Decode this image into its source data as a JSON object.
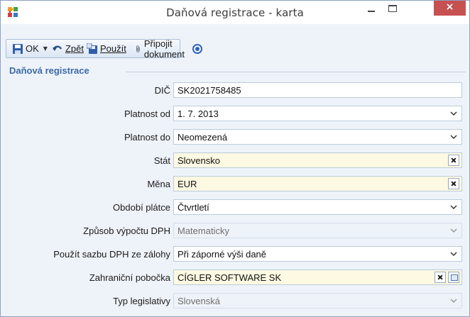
{
  "window": {
    "title": "Daňová registrace - karta",
    "close_glyph": "×",
    "icons": {
      "app": "app-puzzle-icon",
      "minimize": "minimize-icon",
      "maximize": "maximize-icon",
      "close": "close-icon"
    }
  },
  "toolbar": {
    "ok_label": "OK",
    "back_label": "Zpět",
    "apply_label": "Použít",
    "attach_label": "Připojit dokument",
    "icons": {
      "ok": "floppy-save-icon",
      "back": "undo-arrow-icon",
      "apply": "apply-save-icon",
      "attach": "paperclip-icon",
      "help": "help-icon"
    }
  },
  "group": {
    "title": "Daňová registrace"
  },
  "fields": [
    {
      "label": "DIČ",
      "value": "SK2021758485",
      "kind": "text"
    },
    {
      "label": "Platnost od",
      "value": "1. 7. 2013",
      "kind": "dropdown"
    },
    {
      "label": "Platnost do",
      "value": "Neomezená",
      "kind": "dropdown"
    },
    {
      "label": "Stát",
      "value": "Slovensko",
      "kind": "lookup-clear"
    },
    {
      "label": "Měna",
      "value": "EUR",
      "kind": "lookup-clear"
    },
    {
      "label": "Období plátce",
      "value": "Čtvrtletí",
      "kind": "dropdown"
    },
    {
      "label": "Způsob výpočtu DPH",
      "value": "Matematicky",
      "kind": "dropdown-disabled"
    },
    {
      "label": "Použít sazbu DPH ze zálohy",
      "value": "Při záporné výši daně",
      "kind": "dropdown"
    },
    {
      "label": "Zahraniční pobočka",
      "value": "CÍGLER SOFTWARE SK",
      "kind": "lookup-clear-card"
    },
    {
      "label": "Typ legislativy",
      "value": "Slovenská",
      "kind": "dropdown-disabled"
    }
  ],
  "colors": {
    "accent": "#3a6aa8",
    "close": "#c75050",
    "lookup_bg": "#fdf9e2",
    "frame_bg": "#eef3fa"
  }
}
